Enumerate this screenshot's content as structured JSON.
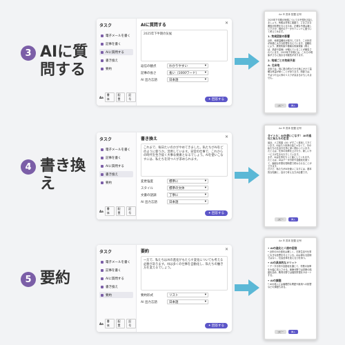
{
  "colors": {
    "accent": "#7b5ea7",
    "button": "#5c56c8",
    "arrow": "#5bb8d6"
  },
  "sidebar": {
    "title": "タスク",
    "items": [
      "電子メールを書く",
      "記事を書く",
      "AIに質問する",
      "書き換え",
      "要約"
    ],
    "footer": [
      "Aa",
      "書体",
      "配置",
      "記号"
    ]
  },
  "steps": [
    {
      "num": "3",
      "title": "AIに質問する",
      "panel": {
        "title": "AIに質問する",
        "text": "2025年下半期の気候",
        "fields": [
          [
            "返信の観点",
            "わかりやすい"
          ],
          [
            "記事の長さ",
            "長い（1000ワード）"
          ],
          [
            "AI 出力言語",
            "日本語"
          ]
        ],
        "button": "回答する"
      },
      "phone": {
        "bar": "Aa ☰ 書体 配置 記号",
        "p1": "2025年下半期の気候についての予想をお話しましょう。気候は非常に複雑で、さまざまな要因が影響を与えるため、正確な予測は難しいですが、現在のデータやトレンドに基づいて考えてみます。",
        "h1": "1. 気候変動の影響",
        "p2": "近年、地球温暖化が進行しており、この状況が気候に大きな影響を与えています。温暖化により、異常気象や極端な気象現象（例えば、熱波や豪雨）が増えていることが報告されています。2025年下半期には、これらの現象がさらに強まる可能性があります。",
        "h2": "2. 地域ごとの気候予測",
        "h3": "A. 北米地",
        "p3": "北米では、特に夏の終わりから秋にかけて温暖な気温が続くことがあります。西部では、干ばつや山火事のリスクが高まるかもしれません。",
        "btns": [
          "コピー",
          "挿入"
        ]
      }
    },
    {
      "num": "4",
      "title": "書き換え",
      "panel": {
        "title": "書き換え",
        "text": "これまで、毎日たいのかがやめてきました。私たちがAIをどのように使うか。活用しています。日常の仕事で、これからの時代を生き抜く大事な要素となるでしょう。AIを使いこなすには、私たちを持つ人が求められます。",
        "fields": [
          [
            "変更強度",
            "標準に"
          ],
          [
            "スタイル",
            "標準の文体"
          ],
          [
            "文書の語調",
            "丁寧に"
          ],
          [
            "AI 出力言語",
            "日本語"
          ]
        ],
        "button": "回答する"
      },
      "phone": {
        "bar": "Aa ☰ 書体 配置 記号",
        "h1": "タイトル：AIを使いこなす！ AIの進化と私たちの生活",
        "p1": "最近、人工知能（AI）がすごく進化してきています。AIはもう未来の話じゃなくて、今の私たちの生活や仕事に深く関わっています。たとえば、仕事の効率を上げたり、新しいサービスが生まれたりしています。",
        "p2": "まず、AIは仕事をもっと楽にしてくれます。たとえば、AIはデータ分析や自動化を使って、面倒な作業を短時間で終わらせることができます。",
        "p3": "だけど、私たちがAIを使いこなすには、基本的な知識と、自分で考える力が必要です。",
        "btns": [
          "コピー",
          "挿入"
        ]
      }
    },
    {
      "num": "5",
      "title": "要約",
      "panel": {
        "title": "要約",
        "text": "一方で、私たちはAIの進化がもたらす変化についても考える必要があります。AIは多くの仕事を自動化し、私たちの働き方を変えるでしょう。",
        "fields": [
          [
            "要約形式",
            "リスト"
          ],
          [
            "AI 出力言語",
            "日本語"
          ]
        ],
        "button": "回答する"
      },
      "phone": {
        "bar": "Aa ☰ 書体 配置 記号",
        "h1": "• AIの進化と人間の役割",
        "p1": "• 近年のAIの進化は著しく、日常生活や仕事に大きな影響を与えている。AIは単なる技術ではなく、社会全体を変える力を持つ。",
        "h2": "• AIの具体的なメリット",
        "p2": "• データ分析や自動化を通じて、作業の効率を大幅に向上させる。医療分野では診断の精度を高め、教育分野では個別学習をサポートする。",
        "h3": "• AIの課題",
        "p3": "• AIの導入には倫理的な問題や雇用への影響などの課題もある。",
        "btns": [
          "コピー",
          "挿入"
        ]
      }
    }
  ]
}
